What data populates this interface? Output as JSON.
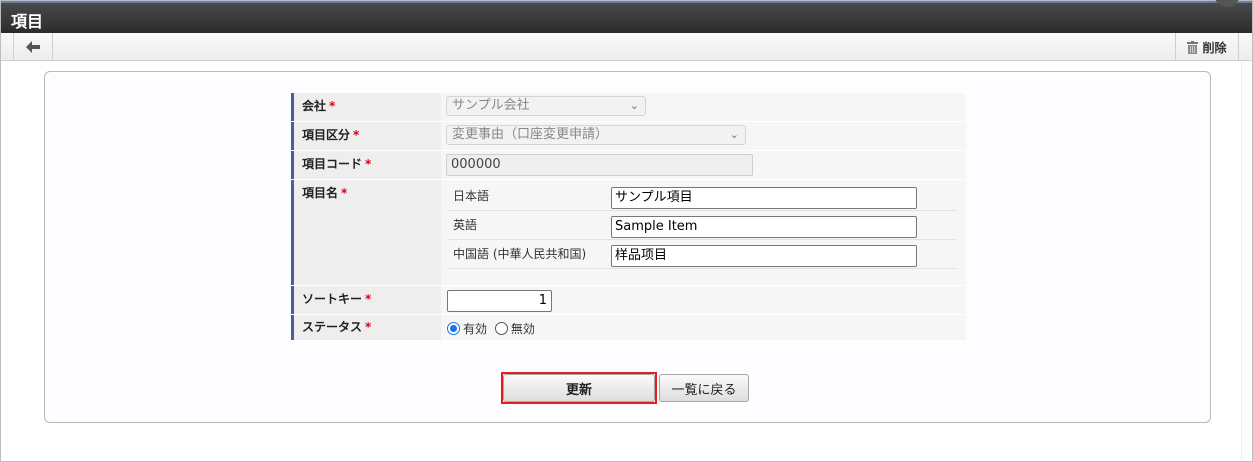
{
  "window": {
    "title": "項目"
  },
  "toolbar": {
    "delete_label": "削除"
  },
  "form": {
    "company": {
      "label": "会社",
      "value": "サンプル会社"
    },
    "item_category": {
      "label": "項目区分",
      "value": "変更事由（口座変更申請）"
    },
    "item_code": {
      "label": "項目コード",
      "value": "000000"
    },
    "item_name": {
      "label": "項目名",
      "locales": [
        {
          "label": "日本語",
          "value": "サンプル項目"
        },
        {
          "label": "英語",
          "value": "Sample Item"
        },
        {
          "label": "中国語 (中華人民共和国)",
          "value": "样品项目"
        }
      ]
    },
    "sort_key": {
      "label": "ソートキー",
      "value": "1"
    },
    "status": {
      "label": "ステータス",
      "options": [
        "有効",
        "無効"
      ],
      "selected": "有効"
    },
    "required_mark": "*"
  },
  "buttons": {
    "update": "更新",
    "back_to_list": "一覧に戻る"
  }
}
